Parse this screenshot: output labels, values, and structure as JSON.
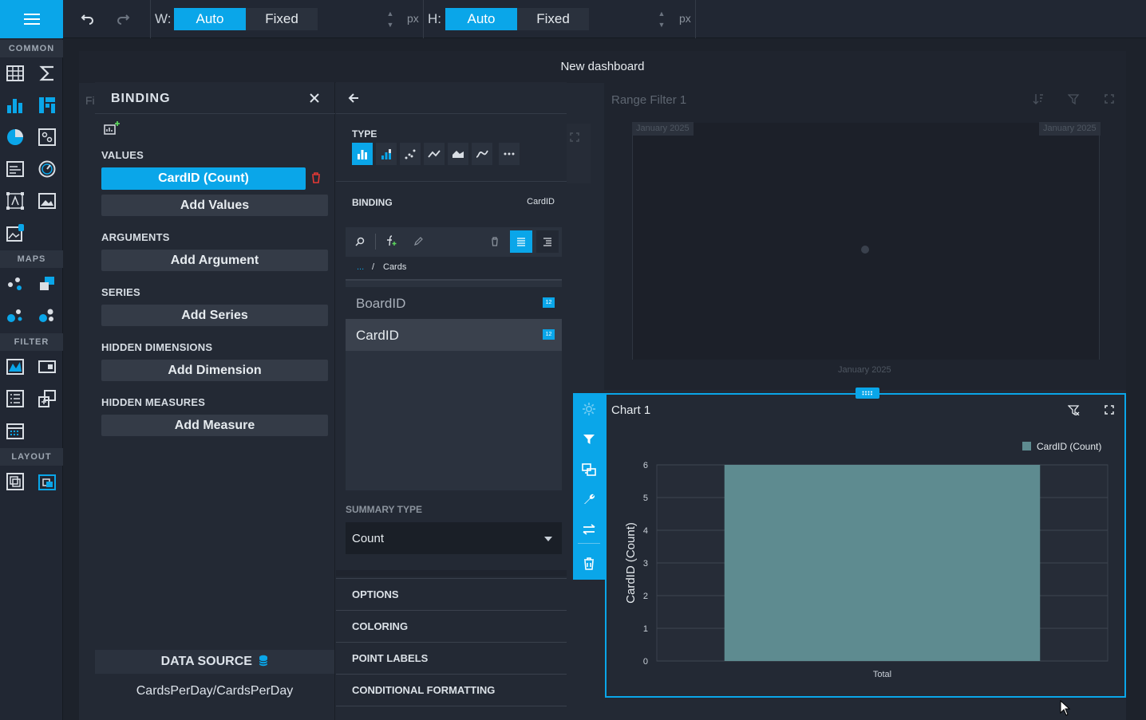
{
  "toolbar": {
    "w_label": "W:",
    "h_label": "H:",
    "auto_label": "Auto",
    "fixed_label": "Fixed",
    "width_value": "",
    "height_value": "",
    "px_unit": "px"
  },
  "sidebar": {
    "common_label": "COMMON",
    "maps_label": "MAPS",
    "filter_label": "FILTER",
    "layout_label": "LAYOUT",
    "accent_color": "#0aa6e9"
  },
  "dashboard": {
    "title": "New dashboard",
    "hidden_item_label": "Fi"
  },
  "binding_panel": {
    "title": "BINDING",
    "values_header": "VALUES",
    "value_item": "CardID (Count)",
    "add_values": "Add Values",
    "arguments_header": "ARGUMENTS",
    "add_argument": "Add Argument",
    "series_header": "SERIES",
    "add_series": "Add Series",
    "hidden_dimensions_header": "HIDDEN DIMENSIONS",
    "add_dimension": "Add Dimension",
    "hidden_measures_header": "HIDDEN MEASURES",
    "add_measure": "Add Measure",
    "data_source_label": "DATA SOURCE",
    "data_source_value": "CardsPerDay/CardsPerDay"
  },
  "data_item_panel": {
    "type_header": "TYPE",
    "binding_header": "BINDING",
    "binding_value": "CardID",
    "breadcrumb_root": "...",
    "breadcrumb_sep": "/",
    "breadcrumb_current": "Cards",
    "fields": [
      {
        "name": "BoardID",
        "badge": "12",
        "selected": false
      },
      {
        "name": "CardID",
        "badge": "12",
        "selected": true
      }
    ],
    "summary_type_header": "SUMMARY TYPE",
    "summary_type_value": "Count",
    "options": [
      "OPTIONS",
      "COLORING",
      "POINT LABELS",
      "CONDITIONAL FORMATTING"
    ]
  },
  "range_filter": {
    "title": "Range Filter 1",
    "left_tag": "January 2025",
    "right_tag": "January 2025",
    "axis_label": "January 2025"
  },
  "chart": {
    "title": "Chart 1"
  },
  "chart_data": {
    "type": "bar",
    "categories": [
      "Total"
    ],
    "series": [
      {
        "name": "CardID (Count)",
        "values": [
          6
        ],
        "color": "#5e8b90"
      }
    ],
    "title": "",
    "xlabel": "",
    "ylabel": "CardID (Count)",
    "ylim": [
      0,
      6
    ],
    "yticks": [
      0,
      1,
      2,
      3,
      4,
      5,
      6
    ],
    "grid": true,
    "legend": "top-right"
  }
}
